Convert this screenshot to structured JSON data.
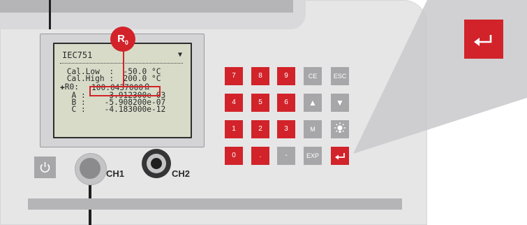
{
  "lcd": {
    "title": "IEC751",
    "lock_glyph": "▼",
    "lines": [
      " Cal.Low  :  -50.0 °C",
      " Cal.High :  200.0 °C",
      "✚R0:              Ω",
      "  A :     3.912300e-03",
      "  B :    -5.908200e-07",
      "  C :    -4.183000e-12"
    ],
    "r0_value": "100.0437000"
  },
  "callout": {
    "r0_letter": "R",
    "r0_sub": "0",
    "enter_icon": "enter-arrow-icon"
  },
  "keypad": {
    "row1": [
      "7",
      "8",
      "9",
      "CE",
      "ESC"
    ],
    "row2": [
      "4",
      "5",
      "6",
      "▲",
      "▼"
    ],
    "row3": [
      "1",
      "2",
      "3",
      "M",
      "light-icon"
    ],
    "row4": [
      "0",
      ".",
      "-",
      "EXP",
      "enter-icon"
    ]
  },
  "controls": {
    "power_icon": "power-icon",
    "ch1_label": "CH1",
    "ch2_label": "CH2"
  },
  "colors": {
    "accent": "#d2232a",
    "key_grey": "#a7a7aa",
    "body": "#e6e6e7",
    "lcd_bg": "#d7dbc8"
  }
}
